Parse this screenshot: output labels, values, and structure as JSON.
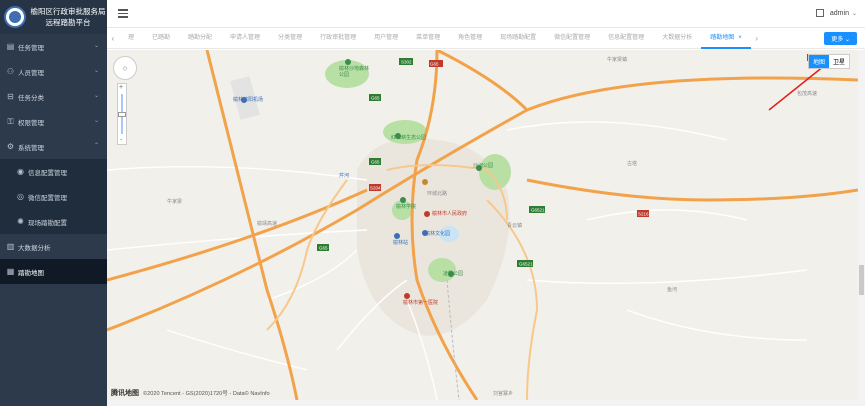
{
  "sidebar": {
    "title": "榆阳区行政审批服务局远程踏勘平台",
    "items": [
      {
        "label": "任务管理",
        "icon": "doc-icon"
      },
      {
        "label": "人员管理",
        "icon": "user-icon"
      },
      {
        "label": "任务分类",
        "icon": "tag-icon"
      },
      {
        "label": "权限管理",
        "icon": "lock-icon"
      },
      {
        "label": "系统管理",
        "icon": "gear-icon"
      }
    ],
    "sub_items": [
      {
        "label": "信息配置管理"
      },
      {
        "label": "微信配置管理"
      },
      {
        "label": "现场踏勘配置"
      }
    ],
    "bottom_items": [
      {
        "label": "大数据分析"
      },
      {
        "label": "踏勘地图"
      }
    ]
  },
  "header": {
    "username": "admin"
  },
  "tabs": {
    "items": [
      "理",
      "已踏勘",
      "踏勘分配",
      "申请人管理",
      "分类管理",
      "行政审批管理",
      "用户管理",
      "菜单管理",
      "角色管理",
      "现场踏勘配置",
      "微信配置管理",
      "信息配置管理",
      "大数据分析"
    ],
    "active": "踏勘地图",
    "more": "更多"
  },
  "map": {
    "type_map": "地图",
    "type_satellite": "卫星",
    "copyright": "©2020 Tencent - GS(2020)1720号 - Data© NavInfo",
    "provider": "腾讯地图",
    "labels": {
      "airport": "榆林榆阳机场",
      "park1": "榆林沙地森林公园",
      "park2": "红石峡生态公园",
      "park3": "凌霄公园",
      "park4": "沙河公园",
      "school": "榆林学院",
      "hospital1": "榆林市人民政府",
      "station": "榆林站",
      "gov": "榆林市第一医院",
      "city": "榆林市",
      "cultural": "榆林文化园",
      "road1": "包茂高速",
      "road2": "榆靖高速",
      "road3": "榆佳高速",
      "road4": "环城北路",
      "road5": "榆溪大道",
      "place1": "牛家梁",
      "place2": "芹河",
      "place3": "鱼河",
      "place4": "青云镇",
      "place5": "古塔",
      "place6": "牛家梁镇",
      "place7": "刘官寨乡",
      "shield1": "S302",
      "shield2": "G65",
      "shield3": "S204",
      "shield4": "G6521",
      "shield5": "S216",
      "shield6": "G65"
    }
  },
  "colors": {
    "sidebar_bg": "#2d3a4b",
    "accent": "#1890ff",
    "highway": "#f2a24a",
    "road": "#ffffff",
    "park": "#b8dfa4"
  }
}
